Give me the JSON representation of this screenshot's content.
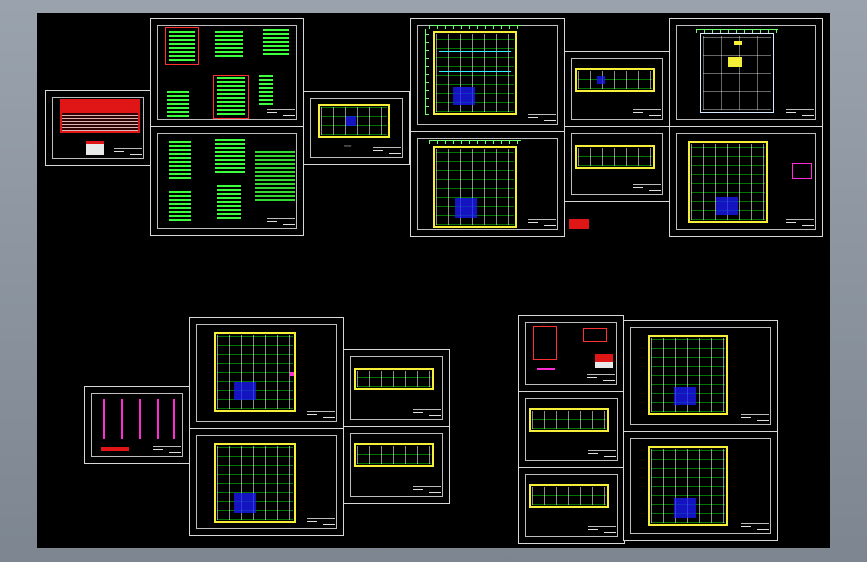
{
  "viewer": {
    "background": "#8f98a2",
    "canvas_color": "#000000",
    "line_colors": {
      "walls": "#f5ef3a",
      "dimensions": "#6cff6c",
      "grid": "#ffffff",
      "ducts": "#2ff5ff",
      "equipment": "#ff2bd6",
      "core": "#1a1aff",
      "red_tables": "#e01515"
    }
  },
  "sheets": [
    {
      "name": "sheet-equipment-schedule",
      "kind": "schedule"
    },
    {
      "name": "sheet-system-diagrams-1",
      "kind": "diagram"
    },
    {
      "name": "sheet-system-diagrams-2",
      "kind": "diagram"
    },
    {
      "name": "sheet-small-floor-plan",
      "kind": "plan"
    },
    {
      "name": "sheet-plan-a",
      "kind": "plan"
    },
    {
      "name": "sheet-plan-b",
      "kind": "plan"
    },
    {
      "name": "sheet-strip-plan-1",
      "kind": "plan"
    },
    {
      "name": "sheet-strip-plan-2",
      "kind": "plan"
    },
    {
      "name": "sheet-roof-plan",
      "kind": "plan"
    },
    {
      "name": "sheet-ground-plan",
      "kind": "plan"
    },
    {
      "name": "sheet-riser-diagram",
      "kind": "diagram"
    },
    {
      "name": "sheet-lower-plan-1",
      "kind": "plan"
    },
    {
      "name": "sheet-lower-plan-2",
      "kind": "plan"
    },
    {
      "name": "sheet-lower-strip-1",
      "kind": "plan"
    },
    {
      "name": "sheet-lower-strip-2",
      "kind": "plan"
    },
    {
      "name": "sheet-legend",
      "kind": "legend"
    },
    {
      "name": "sheet-right-strip-1",
      "kind": "plan"
    },
    {
      "name": "sheet-right-strip-2",
      "kind": "plan"
    },
    {
      "name": "sheet-right-plan-1",
      "kind": "plan"
    },
    {
      "name": "sheet-right-plan-2",
      "kind": "plan"
    }
  ]
}
